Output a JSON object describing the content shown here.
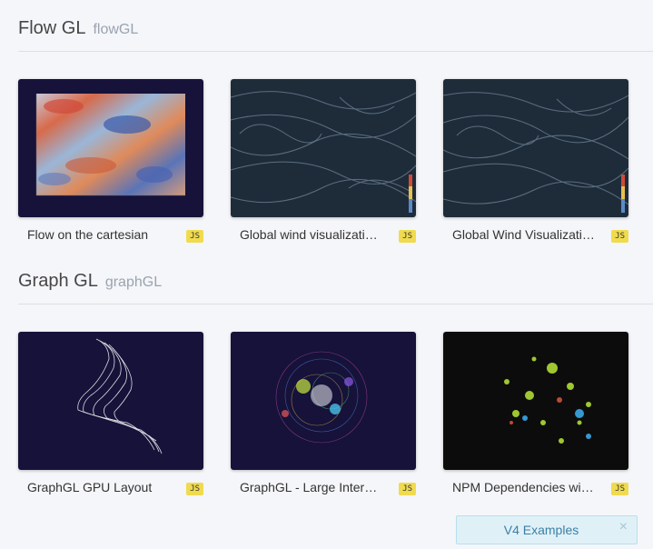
{
  "sections": [
    {
      "title": "Flow GL",
      "subtitle": "flowGL",
      "cards": [
        {
          "title": "Flow on the cartesian",
          "badge": "JS"
        },
        {
          "title": "Global wind visualizati…",
          "badge": "JS"
        },
        {
          "title": "Global Wind Visualizati…",
          "badge": "JS"
        }
      ]
    },
    {
      "title": "Graph GL",
      "subtitle": "graphGL",
      "cards": [
        {
          "title": "GraphGL GPU Layout",
          "badge": "JS"
        },
        {
          "title": "GraphGL - Large Inter…",
          "badge": "JS"
        },
        {
          "title": "NPM Dependencies wi…",
          "badge": "JS"
        }
      ]
    }
  ],
  "banner": {
    "label": "V4 Examples",
    "close": "×"
  },
  "colors": {
    "thumb_bg": "#16123a",
    "badge": "#f0db4f",
    "banner_bg": "#dff1f7"
  }
}
